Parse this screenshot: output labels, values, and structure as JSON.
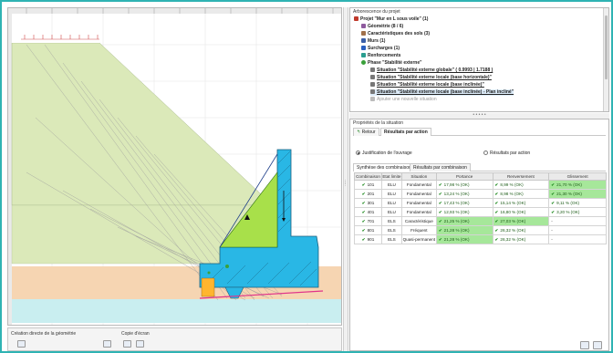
{
  "tree": {
    "title": "Arborescence du projet",
    "items": [
      {
        "label": "Projet \"Mur en L sous voile\" (1)",
        "icon": "project-icon",
        "color": "#c0392b"
      },
      {
        "label": "Géométrie (8 / 6)",
        "icon": "geometry-icon",
        "color": "#8e5a9e"
      },
      {
        "label": "Caractéristiques des sols (3)",
        "icon": "soil-icon",
        "color": "#a0704a"
      },
      {
        "label": "Murs (1)",
        "icon": "wall-icon",
        "color": "#3a5fa8"
      },
      {
        "label": "Surcharges (1)",
        "icon": "load-icon",
        "color": "#2a60c0"
      },
      {
        "label": "Renforcements",
        "icon": "reinforcement-icon",
        "color": "#2a9d8f"
      },
      {
        "label": "Phase \"Stabilité externe\"",
        "icon": "phase-icon",
        "color": "#3aa03a"
      },
      {
        "label": "Situation \"Stabilité externe globale\" ( 0.9993 | 1.7188 )",
        "icon": "situation-icon",
        "color": "#555"
      },
      {
        "label": "Situation \"Stabilité externe locale (base horizontale)\"",
        "icon": "situation-icon",
        "color": "#555"
      },
      {
        "label": "Situation \"Stabilité externe locale (base inclinée)\"",
        "icon": "situation-icon",
        "color": "#555"
      },
      {
        "label": "Situation \"Stabilité externe locale (base inclinée) - Plan incliné\"",
        "icon": "situation-icon",
        "color": "#555"
      },
      {
        "label": "Ajouter une nouvelle situation",
        "icon": "add-icon",
        "color": "#999"
      }
    ]
  },
  "props": {
    "title": "Propriétés de la situation",
    "back_label": "Retour",
    "results_tab": "Résultats par action",
    "radio_justification": "Justification de l'ouvrage",
    "radio_results": "Résultats par action",
    "subtab_synthese": "Synthèse des combinaisons",
    "subtab_results": "Résultats par combinaison"
  },
  "table": {
    "headers": [
      "Combinaison",
      "Etat limite",
      "Situation",
      "Portance",
      "Renversement",
      "Glissement"
    ],
    "rows": [
      {
        "comb": "101",
        "etat": "ELU",
        "situation": "Fondamental",
        "portance": "17,98 % (OK)",
        "renversement": "8,99 % (OK)",
        "glissement": "21,70 % (OK)"
      },
      {
        "comb": "201",
        "etat": "ELU",
        "situation": "Fondamental",
        "portance": "13,24 % (OK)",
        "renversement": "8,98 % (OK)",
        "glissement": "21,30 % (OK)"
      },
      {
        "comb": "301",
        "etat": "ELU",
        "situation": "Fondamental",
        "portance": "17,43 % (OK)",
        "renversement": "15,14 % (OK)",
        "glissement": "9,11 % (OK)"
      },
      {
        "comb": "401",
        "etat": "ELU",
        "situation": "Fondamental",
        "portance": "12,93 % (OK)",
        "renversement": "16,80 % (OK)",
        "glissement": "3,20 % (OK)"
      },
      {
        "comb": "701",
        "etat": "ELS",
        "situation": "Caractéristique",
        "portance": "21,25 % (OK)",
        "renversement": "27,03 % (OK)",
        "glissement": "-"
      },
      {
        "comb": "801",
        "etat": "ELS",
        "situation": "Fréquent",
        "portance": "21,28 % (OK)",
        "renversement": "26,32 % (OK)",
        "glissement": "-"
      },
      {
        "comb": "901",
        "etat": "ELS",
        "situation": "Quasi-permanent",
        "portance": "21,28 % (OK)",
        "renversement": "26,32 % (OK)",
        "glissement": "-"
      }
    ]
  },
  "bottom": {
    "geometry_label": "Création directe de la géométrie",
    "copy_label": "Copie d'écran"
  },
  "colors": {
    "accent": "#2fb3b3",
    "soil_upper": "#dbe9b9",
    "soil_mid": "#f6d5b2",
    "soil_lower": "#c9eef0",
    "wall": "#29b7e5",
    "ok": "#a6e79a"
  }
}
